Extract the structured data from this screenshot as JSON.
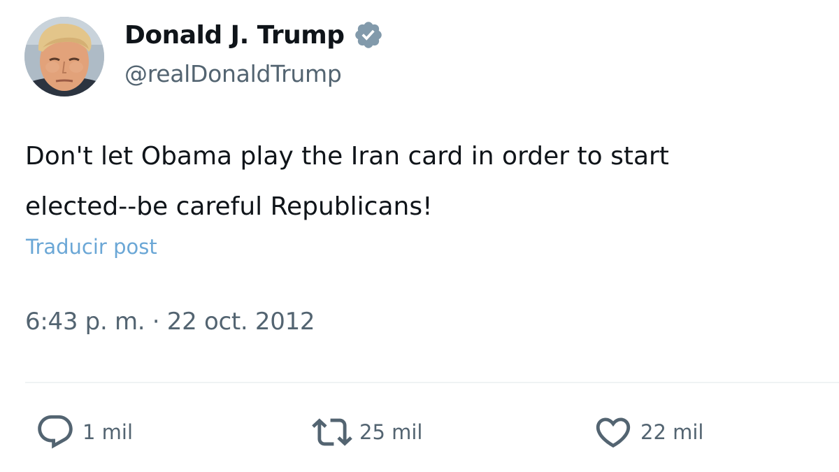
{
  "author": {
    "display_name": "Donald J. Trump",
    "handle": "@realDonaldTrump",
    "verified": true,
    "verified_color": "#829aab"
  },
  "tweet": {
    "text_lines": [
      "Don't let Obama play the Iran card in order to start",
      "elected--be careful Republicans!"
    ],
    "translate_label": "Traducir post",
    "timestamp": "6:43 p. m. · 22 oct. 2012"
  },
  "actions": {
    "reply": {
      "icon": "reply-icon",
      "count": "1 mil"
    },
    "retweet": {
      "icon": "retweet-icon",
      "count": "25 mil"
    },
    "like": {
      "icon": "heart-icon",
      "count": "22 mil"
    }
  },
  "colors": {
    "text_primary": "#0f1419",
    "text_secondary": "#536471",
    "link": "#6ba7d6",
    "divider": "#eff3f4"
  }
}
